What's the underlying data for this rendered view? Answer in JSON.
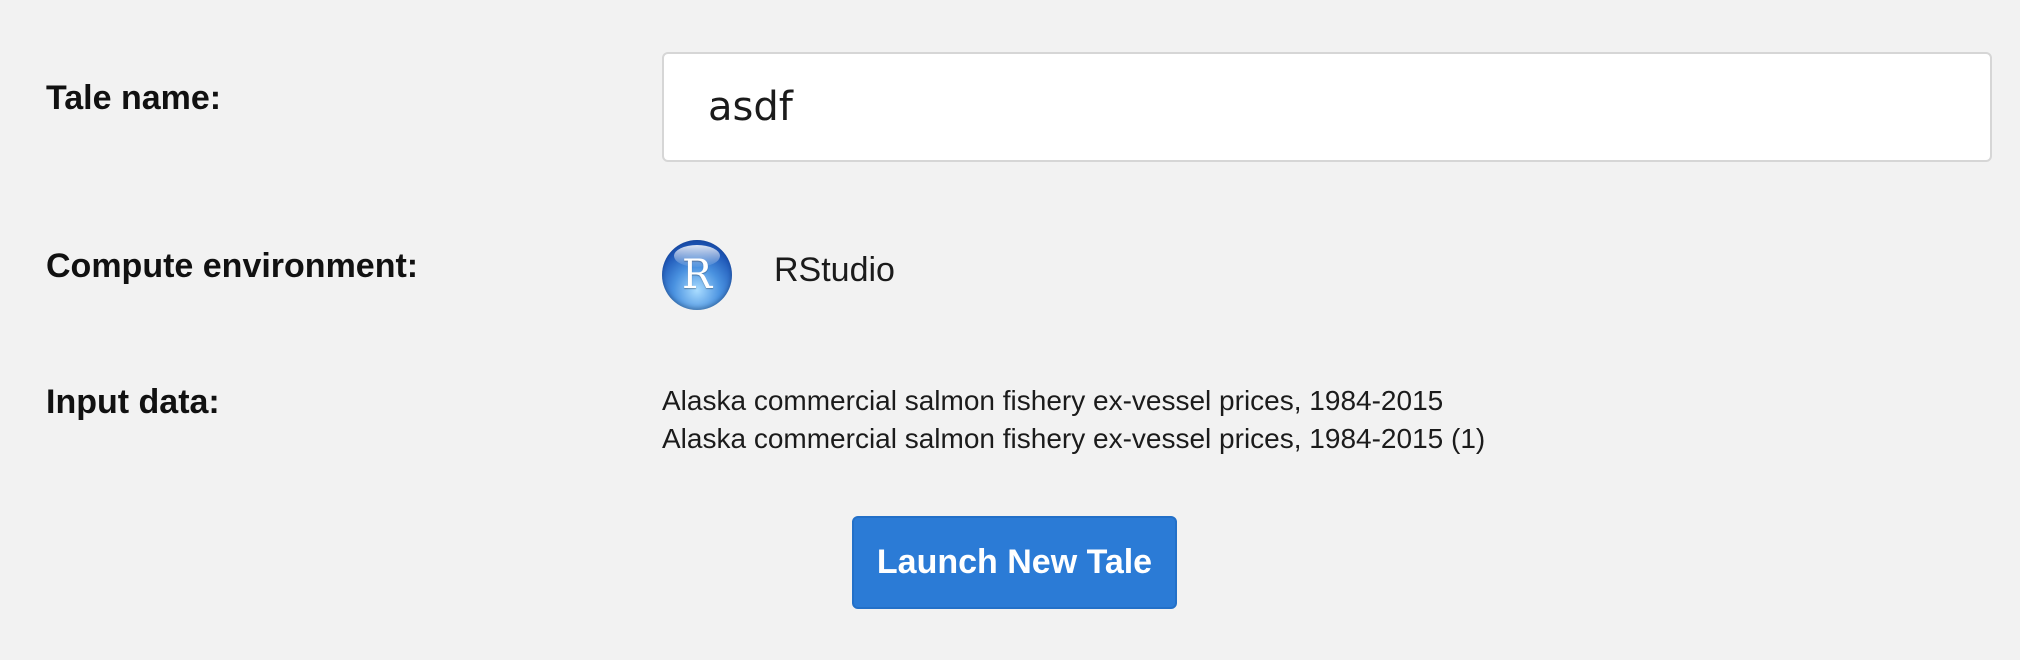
{
  "form": {
    "tale_name_label": "Tale name:",
    "tale_name_value": "asdf",
    "compute_env_label": "Compute environment:",
    "compute_env": {
      "icon": "r-logo-icon",
      "icon_letter": "R",
      "name": "RStudio",
      "icon_color": "#1d55b6"
    },
    "input_data_label": "Input data:",
    "input_data": [
      "Alaska commercial salmon fishery ex-vessel prices, 1984-2015",
      "Alaska commercial salmon fishery ex-vessel prices, 1984-2015 (1)"
    ],
    "launch_label": "Launch New Tale",
    "launch_color": "#2b7bd6",
    "background": "#f2f2f2"
  }
}
